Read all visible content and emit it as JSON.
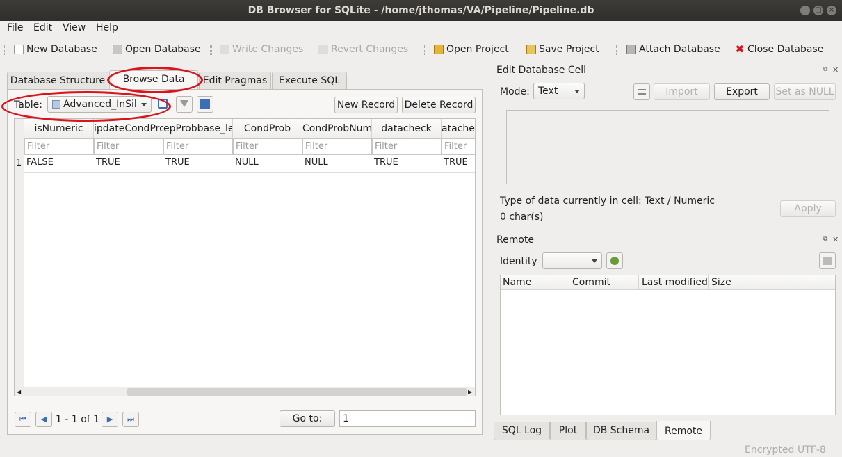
{
  "window": {
    "title": "DB Browser for SQLite - /home/jthomas/VA/Pipeline/Pipeline.db"
  },
  "menu": {
    "file": "File",
    "edit": "Edit",
    "view": "View",
    "help": "Help"
  },
  "toolbar": {
    "new_db": "New Database",
    "open_db": "Open Database",
    "write": "Write Changes",
    "revert": "Revert Changes",
    "open_project": "Open Project",
    "save_project": "Save Project",
    "attach": "Attach Database",
    "close_db": "Close Database"
  },
  "tabs": {
    "structure": "Database Structure",
    "browse": "Browse Data",
    "pragmas": "Edit Pragmas",
    "sql": "Execute SQL"
  },
  "browse": {
    "table_label": "Table:",
    "table_value": "Advanced_InSil",
    "new_record": "New Record",
    "delete_record": "Delete Record",
    "columns": [
      "isNumeric",
      "ipdateCondProl",
      "epProbbase_lev",
      "CondProb",
      "CondProbNum",
      "datacheck",
      "atachec"
    ],
    "filter_placeholder": "Filter",
    "row_number": "1",
    "row": [
      "FALSE",
      "TRUE",
      "TRUE",
      "NULL",
      "NULL",
      "TRUE",
      "TRUE"
    ],
    "pager": "1 - 1 of 1",
    "goto_label": "Go to:",
    "goto_value": "1"
  },
  "edit_cell": {
    "title": "Edit Database Cell",
    "mode_label": "Mode:",
    "mode_value": "Text",
    "import": "Import",
    "export": "Export",
    "set_null": "Set as NULL",
    "type_info": "Type of data currently in cell: Text / Numeric",
    "chars": "0 char(s)",
    "apply": "Apply"
  },
  "remote": {
    "title": "Remote",
    "identity_label": "Identity",
    "columns": [
      "Name",
      "Commit",
      "Last modified",
      "Size"
    ]
  },
  "bottom_tabs": {
    "log": "SQL Log",
    "plot": "Plot",
    "schema": "DB Schema",
    "remote": "Remote"
  },
  "status": {
    "encrypted": "Encrypted",
    "encoding": "UTF-8"
  },
  "colors": {
    "highlight": "#d9141b",
    "titlebar": "#2f2e2b"
  }
}
